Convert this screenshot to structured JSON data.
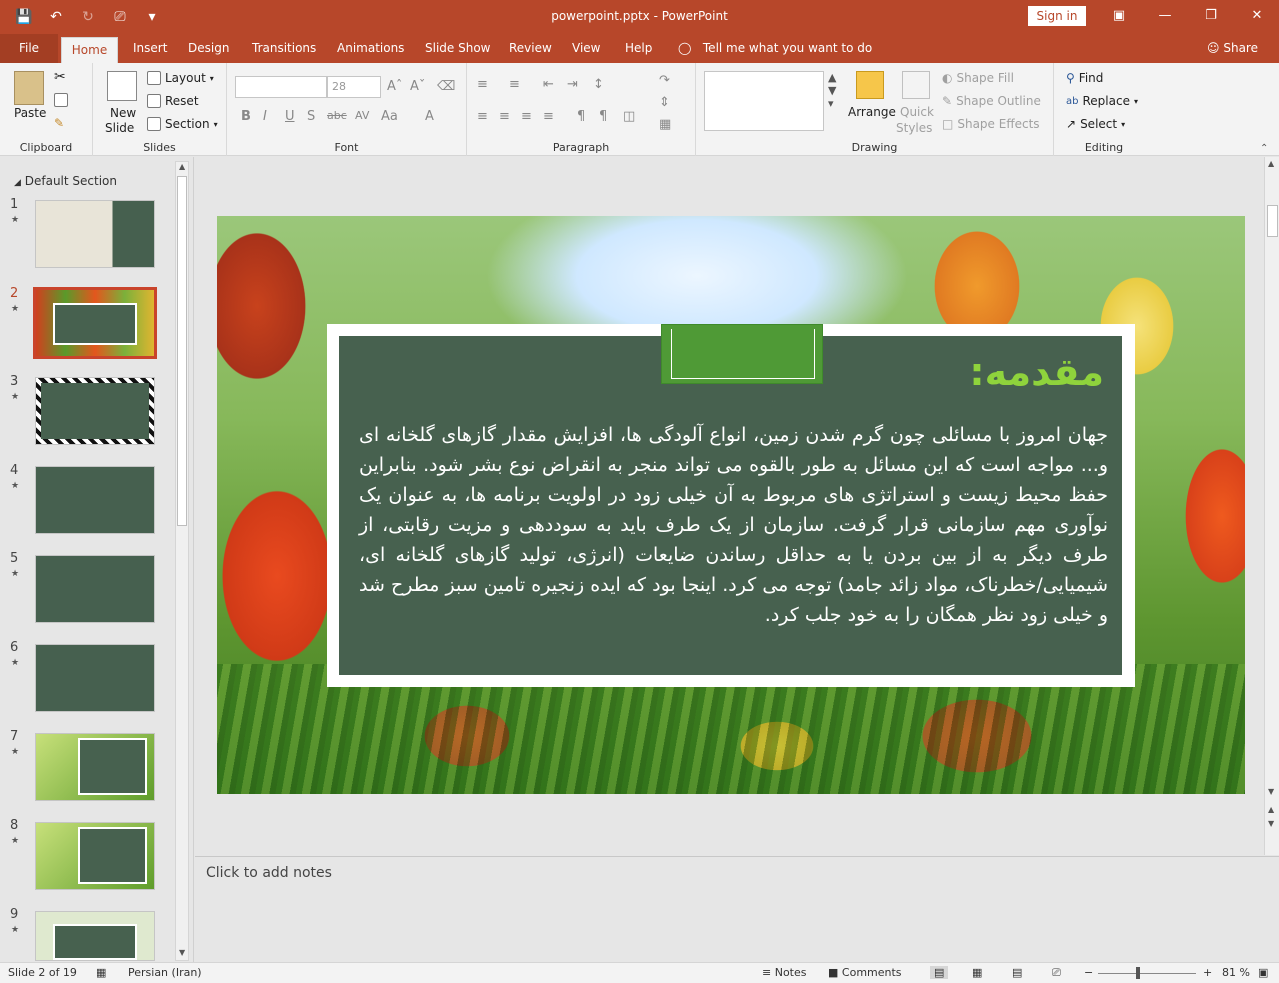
{
  "window": {
    "title": "powerpoint.pptx  -  PowerPoint",
    "sign_in": "Sign in"
  },
  "tabs": [
    {
      "label": "File"
    },
    {
      "label": "Home"
    },
    {
      "label": "Insert"
    },
    {
      "label": "Design"
    },
    {
      "label": "Transitions"
    },
    {
      "label": "Animations"
    },
    {
      "label": "Slide Show"
    },
    {
      "label": "Review"
    },
    {
      "label": "View"
    },
    {
      "label": "Help"
    }
  ],
  "tell_me": "Tell me what you want to do",
  "share": "Share",
  "ribbon": {
    "clipboard": {
      "label": "Clipboard",
      "paste": "Paste"
    },
    "slides": {
      "label": "Slides",
      "new_slide": "New",
      "new_slide2": "Slide",
      "layout": "Layout",
      "reset": "Reset",
      "section": "Section"
    },
    "font": {
      "label": "Font",
      "size": "28"
    },
    "paragraph": {
      "label": "Paragraph"
    },
    "drawing": {
      "label": "Drawing",
      "arrange": "Arrange",
      "quick_styles": "Quick",
      "quick_styles2": "Styles",
      "shape_fill": "Shape Fill",
      "shape_outline": "Shape Outline",
      "shape_effects": "Shape Effects"
    },
    "editing": {
      "label": "Editing",
      "find": "Find",
      "replace": "Replace",
      "select": "Select"
    }
  },
  "thumbnails": {
    "section_name": "Default Section",
    "items": [
      {
        "num": "1"
      },
      {
        "num": "2"
      },
      {
        "num": "3"
      },
      {
        "num": "4"
      },
      {
        "num": "5"
      },
      {
        "num": "6"
      },
      {
        "num": "7"
      },
      {
        "num": "8"
      },
      {
        "num": "9"
      }
    ]
  },
  "slide": {
    "title": "مقدمه:",
    "body": "جهان امروز با مسائلی چون گرم شدن زمین، انواع آلودگی ها، افزایش مقدار گازهای گلخانه ای و... مواجه است که این مسائل به طور بالقوه می تواند منجر به انقراض نوع بشر شود. بنابراین حفظ محیط زیست و استراتژی های مربوط به آن خیلی زود در اولویت برنامه ها، به عنوان یک نوآوری مهم سازمانی قرار گرفت. سازمان از یک طرف باید به سوددهی و مزیت رقابتی، از طرف دیگر به از بین بردن یا به حداقل رساندن ضایعات (انرژی، تولید گازهای گلخانه ای، شیمیایی/خطرناک، مواد زائد جامد) توجه می کرد. اینجا بود که ایده زنجیره تامین سبز مطرح شد و خیلی زود نظر همگان را به خود جلب کرد."
  },
  "notes_placeholder": "Click to add notes",
  "status": {
    "slide_info": "Slide 2 of 19",
    "language": "Persian (Iran)",
    "notes": "Notes",
    "comments": "Comments",
    "zoom": "81 %"
  },
  "colors": {
    "accent": "#b7472a",
    "panel": "#47614f",
    "title_green": "#8fd33c"
  }
}
